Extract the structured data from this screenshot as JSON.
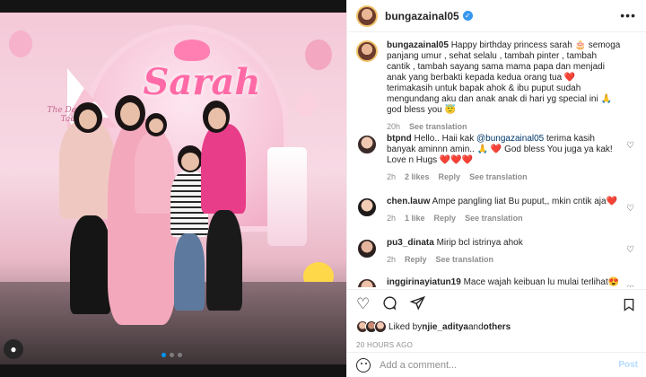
{
  "photo": {
    "sign_text": "Sarah",
    "tent_text": "The Dessert Table",
    "carousel": {
      "total": 3,
      "active_index": 0
    },
    "icons": {
      "user_badge": "user-tag-icon"
    }
  },
  "post": {
    "username": "bungazainal05",
    "verified": true,
    "more_icon": "more-horizontal-icon"
  },
  "caption": {
    "username": "bungazainal05",
    "text": "Happy birthday princess sarah 🎂 semoga panjang umur , sehat selalu , tambah pinter , tambah cantik , tambah sayang sama mama papa dan menjadi anak yang berbakti kepada kedua orang tua ❤️ terimakasih untuk bapak ahok & ibu puput sudah mengundang aku dan anak anak di hari yg special ini 🙏 god bless you 😇",
    "time": "20h",
    "see_translation": "See translation"
  },
  "comments": [
    {
      "username": "btpnd",
      "pre_mention": "Hello.. Haii kak ",
      "mention": "@bungazainal05",
      "text": " terima kasih banyak aminnn amin.. 🙏 ❤️ God bless You juga ya kak! Love n Hugs ❤️❤️❤️",
      "time": "2h",
      "likes": "2 likes",
      "reply": "Reply",
      "see_translation": "See translation"
    },
    {
      "username": "chen.lauw",
      "text": "Ampe pangling liat Bu puput,, mkin cntik aja❤️",
      "time": "2h",
      "likes": "1 like",
      "reply": "Reply",
      "see_translation": "See translation"
    },
    {
      "username": "pu3_dinata",
      "text": "Mirip bcl istrinya ahok",
      "time": "2h",
      "reply": "Reply",
      "see_translation": "See translation"
    },
    {
      "username": "inggirinayiatun19",
      "text": "Mace wajah keibuan lu mulai terlihat😍"
    }
  ],
  "actions": {
    "like_icon": "heart-icon",
    "comment_icon": "comment-icon",
    "share_icon": "share-icon",
    "save_icon": "bookmark-icon"
  },
  "likes": {
    "prefix": "Liked by ",
    "user": "njie_aditya",
    "conj": " and ",
    "others": "others"
  },
  "timestamp": "20 HOURS AGO",
  "add_comment": {
    "placeholder": "Add a comment...",
    "post_label": "Post",
    "emoji_icon": "emoji-icon"
  },
  "colors": {
    "link": "#00376b",
    "accent": "#0095f6",
    "post_disabled": "#b3dbff",
    "muted": "#8e8e8e",
    "heart_red": "#ed1c45"
  }
}
